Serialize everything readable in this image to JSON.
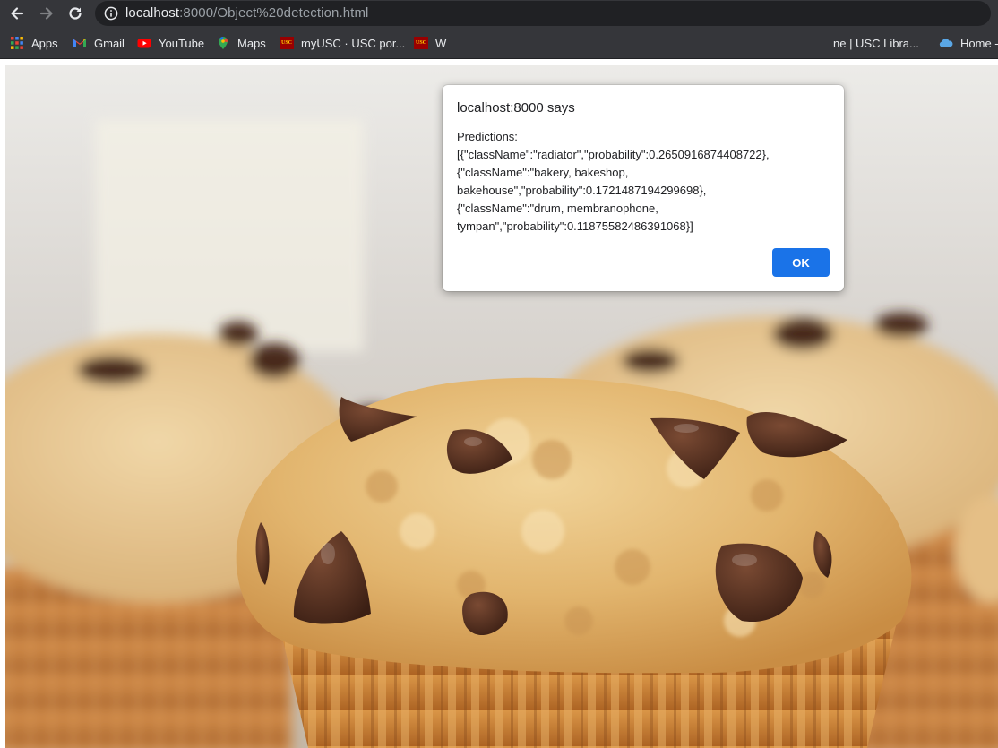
{
  "browser": {
    "url_host": "localhost",
    "url_rest": ":8000/Object%20detection.html",
    "colors": {
      "toolbar": "#35363a",
      "omnibox": "#202124",
      "accent": "#1a73e8"
    }
  },
  "bookmarks": [
    {
      "label": "Apps",
      "icon": "apps-grid-icon"
    },
    {
      "label": "Gmail",
      "icon": "gmail-icon"
    },
    {
      "label": "YouTube",
      "icon": "youtube-icon"
    },
    {
      "label": "Maps",
      "icon": "maps-pin-icon"
    },
    {
      "label": "myUSC · USC por...",
      "icon": "usc-logo-icon"
    },
    {
      "label": "W",
      "icon": "usc-logo-icon"
    },
    {
      "label": "ne | USC Libra...",
      "icon": "page-icon"
    },
    {
      "label": "Home -",
      "icon": "cloud-icon"
    }
  ],
  "dialog": {
    "title": "localhost:8000 says",
    "message_lines": [
      "Predictions:",
      "[{\"className\":\"radiator\",\"probability\":0.2650916874408722},",
      "{\"className\":\"bakery, bakeshop,",
      "bakehouse\",\"probability\":0.1721487194299698},",
      "{\"className\":\"drum, membranophone,",
      "tympan\",\"probability\":0.11875582486391068}]"
    ],
    "ok_label": "OK"
  },
  "page": {
    "image_subject": "chocolate-chip-muffins-photo"
  }
}
